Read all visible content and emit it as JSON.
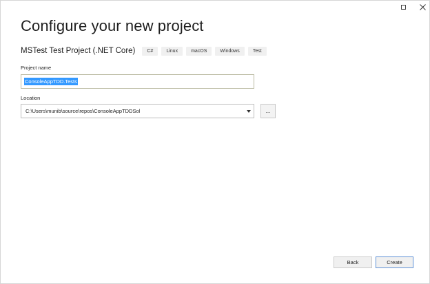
{
  "window": {
    "maximize_icon": "maximize-icon",
    "close_icon": "close-icon"
  },
  "heading": "Configure your new project",
  "template": {
    "name": "MSTest Test Project (.NET Core)",
    "tags": [
      "C#",
      "Linux",
      "macOS",
      "Windows",
      "Test"
    ]
  },
  "project_name": {
    "label": "Project name",
    "value": "ConsoleAppTDD.Tests"
  },
  "location": {
    "label": "Location",
    "value": "C:\\Users\\munib\\source\\repos\\ConsoleAppTDDSol",
    "browse_label": "..."
  },
  "footer": {
    "back_label": "Back",
    "create_label": "Create"
  },
  "colors": {
    "selection": "#3399ff",
    "create_border": "#5b8fd6"
  }
}
